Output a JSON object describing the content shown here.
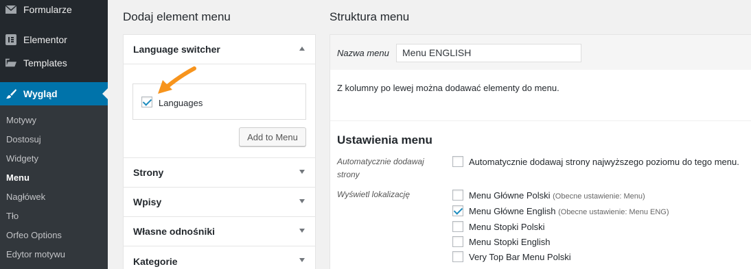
{
  "sidebar": {
    "items": [
      {
        "label": "Formularze",
        "icon": "envelope-icon"
      },
      {
        "label": "Elementor",
        "icon": "elementor-icon"
      },
      {
        "label": "Templates",
        "icon": "folder-icon"
      },
      {
        "label": "Wygląd",
        "icon": "brush-icon"
      }
    ],
    "submenu": [
      "Motywy",
      "Dostosuj",
      "Widgety",
      "Menu",
      "Nagłówek",
      "Tło",
      "Orfeo Options",
      "Edytor motywu"
    ],
    "current_sub": "Menu",
    "active_color": "#0073aa"
  },
  "left": {
    "heading": "Dodaj element menu",
    "open_section": {
      "title": "Language switcher",
      "item_label": "Languages",
      "item_checked": true,
      "add_button": "Add to Menu"
    },
    "sections": [
      "Strony",
      "Wpisy",
      "Własne odnośniki",
      "Kategorie"
    ]
  },
  "right": {
    "heading": "Struktura menu",
    "menu_name_label": "Nazwa menu",
    "menu_name_value": "Menu ENGLISH",
    "info": "Z kolumny po lewej można dodawać elementy do menu.",
    "settings_title": "Ustawienia menu",
    "auto_add": {
      "label": "Automatycznie dodawaj strony",
      "option": "Automatycznie dodawaj strony najwyższego poziomu do tego menu.",
      "checked": false
    },
    "locations": {
      "label": "Wyświetl lokalizację",
      "options": [
        {
          "label": "Menu Główne Polski",
          "note": "(Obecne ustawienie: Menu)",
          "checked": false
        },
        {
          "label": "Menu Główne English",
          "note": "(Obecne ustawienie: Menu ENG)",
          "checked": true
        },
        {
          "label": "Menu Stopki Polski",
          "note": "",
          "checked": false
        },
        {
          "label": "Menu Stopki English",
          "note": "",
          "checked": false
        },
        {
          "label": "Very Top Bar Menu Polski",
          "note": "",
          "checked": false
        }
      ]
    }
  },
  "annotation_color": "#f7941d"
}
